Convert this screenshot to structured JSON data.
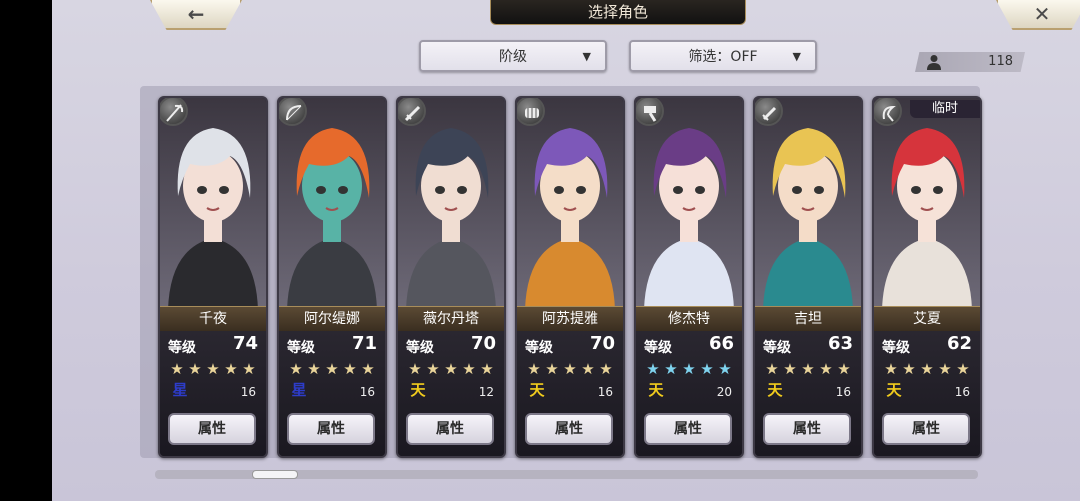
{
  "header": {
    "title": "选择角色",
    "back_icon": "arrow-left-icon",
    "close_icon": "close-icon"
  },
  "filters": {
    "grade_label": "阶级",
    "filter_label": "筛选：OFF"
  },
  "roster_count": "118",
  "attr_label": "属性",
  "level_label": "等级",
  "colors": {
    "gold_star": "#e9d49a",
    "blue_star": "#7fd3ee",
    "heaven_rank": "#f1cc1d",
    "star_rank": "#2d3cc8"
  },
  "characters": [
    {
      "name": "千夜",
      "level": "74",
      "stars": 5,
      "star_color": "gold",
      "rank_glyph": "星",
      "rank_color": "blue",
      "rank_num": "16",
      "weapon_icon": "scythe-icon",
      "temp": ""
    },
    {
      "name": "阿尔缇娜",
      "level": "71",
      "stars": 5,
      "star_color": "gold",
      "rank_glyph": "星",
      "rank_color": "blue",
      "rank_num": "16",
      "weapon_icon": "bow-icon",
      "temp": ""
    },
    {
      "name": "薇尔丹塔",
      "level": "70",
      "stars": 5,
      "star_color": "gold",
      "rank_glyph": "天",
      "rank_color": "gold",
      "rank_num": "12",
      "weapon_icon": "sword-icon",
      "temp": ""
    },
    {
      "name": "阿苏提雅",
      "level": "70",
      "stars": 5,
      "star_color": "gold",
      "rank_glyph": "天",
      "rank_color": "gold",
      "rank_num": "16",
      "weapon_icon": "fist-icon",
      "temp": ""
    },
    {
      "name": "修杰特",
      "level": "66",
      "stars": 5,
      "star_color": "blue",
      "rank_glyph": "天",
      "rank_color": "gold",
      "rank_num": "20",
      "weapon_icon": "hammer-icon",
      "temp": ""
    },
    {
      "name": "吉坦",
      "level": "63",
      "stars": 5,
      "star_color": "gold",
      "rank_glyph": "天",
      "rank_color": "gold",
      "rank_num": "16",
      "weapon_icon": "dagger-icon",
      "temp": ""
    },
    {
      "name": "艾夏",
      "level": "62",
      "stars": 5,
      "star_color": "gold",
      "rank_glyph": "天",
      "rank_color": "gold",
      "rank_num": "16",
      "weapon_icon": "sickle-icon",
      "temp": "临时"
    }
  ]
}
